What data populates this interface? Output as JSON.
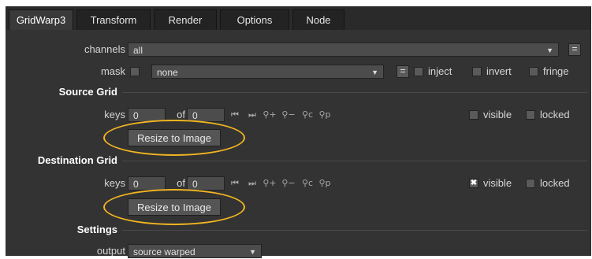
{
  "tabs": [
    {
      "label": "GridWarp3"
    },
    {
      "label": "Transform"
    },
    {
      "label": "Render"
    },
    {
      "label": "Options"
    },
    {
      "label": "Node"
    }
  ],
  "channels": {
    "label": "channels",
    "value": "all",
    "button": "="
  },
  "mask": {
    "label": "mask",
    "value": "none",
    "button": "=",
    "inject": "inject",
    "invert": "invert",
    "fringe": "fringe"
  },
  "source_grid": {
    "header": "Source Grid",
    "keys_label": "keys",
    "keys_value": "0",
    "of_label": "of",
    "of_value": "0",
    "visible_label": "visible",
    "visible_checked": false,
    "locked_label": "locked",
    "locked_checked": false,
    "resize_button": "Resize to Image"
  },
  "destination_grid": {
    "header": "Destination Grid",
    "keys_label": "keys",
    "keys_value": "0",
    "of_label": "of",
    "of_value": "0",
    "visible_label": "visible",
    "visible_checked": true,
    "visible_mark": "✖",
    "locked_label": "locked",
    "locked_checked": false,
    "resize_button": "Resize to Image"
  },
  "settings": {
    "header": "Settings",
    "output_label": "output",
    "output_value": "source warped"
  },
  "key_icons": [
    "prev-key-icon",
    "next-key-icon",
    "add-key-icon",
    "delete-key-icon",
    "copy-key-icon",
    "paste-key-icon"
  ],
  "colors": {
    "panel": "#333333",
    "highlight_ring": "#f2b521"
  }
}
